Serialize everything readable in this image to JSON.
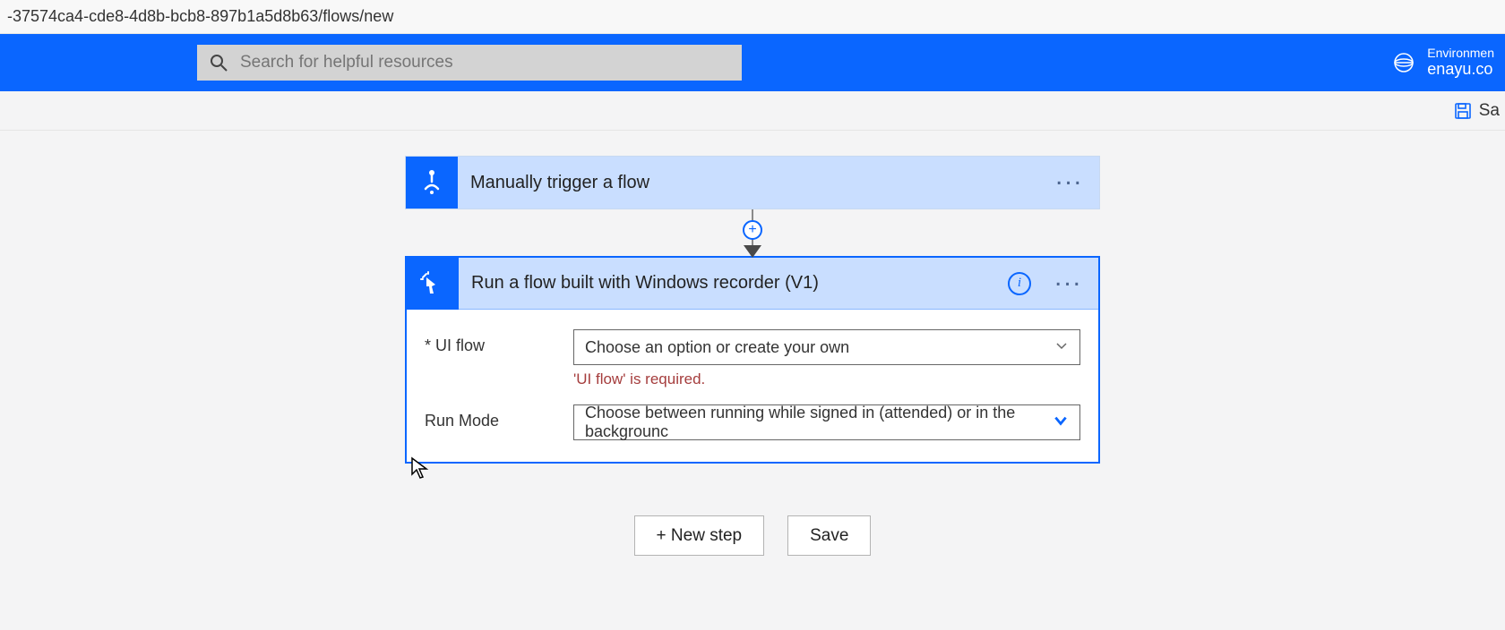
{
  "addressbar": {
    "url": "-37574ca4-cde8-4d8b-bcb8-897b1a5d8b63/flows/new"
  },
  "search": {
    "placeholder": "Search for helpful resources"
  },
  "environment": {
    "label": "Environmen",
    "name": "enayu.co"
  },
  "subbar": {
    "save": "Sa"
  },
  "trigger": {
    "title": "Manually trigger a flow"
  },
  "action": {
    "title": "Run a flow built with Windows recorder (V1)",
    "fields": {
      "uiflow": {
        "label": "* UI flow",
        "placeholder": "Choose an option or create your own",
        "error": "'UI flow' is required."
      },
      "runmode": {
        "label": "Run Mode",
        "placeholder": "Choose between running while signed in (attended) or in the backgrounc"
      }
    }
  },
  "buttons": {
    "newstep": "+ New step",
    "save": "Save"
  }
}
